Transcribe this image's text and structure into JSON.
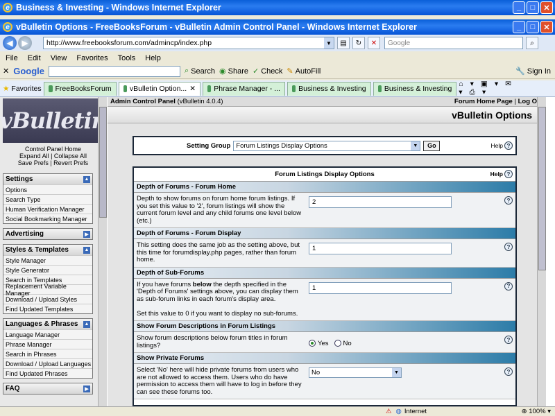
{
  "back_window": {
    "title": "Business & Investing - Windows Internet Explorer"
  },
  "window": {
    "title": "vBulletin Options - FreeBooksForum - vBulletin Admin Control Panel - Windows Internet Explorer"
  },
  "address": {
    "url": "http://www.freebooksforum.com/admincp/index.php",
    "search_placeholder": "Google"
  },
  "menu": [
    "File",
    "Edit",
    "View",
    "Favorites",
    "Tools",
    "Help"
  ],
  "google_bar": {
    "brand": "Google",
    "search": "Search",
    "share": "Share",
    "check": "Check",
    "autofill": "AutoFill",
    "sign_in": "Sign In"
  },
  "tabs_bar": {
    "favorites": "Favorites",
    "tabs": [
      "FreeBooksForum",
      "vBulletin Option...",
      "Phrase Manager - ...",
      "Business & Investing",
      "Business & Investing"
    ]
  },
  "sidebar": {
    "logo": "vBulletin",
    "cp_home": "Control Panel Home",
    "expand_all": "Expand All",
    "collapse_all": "Collapse All",
    "save_prefs": "Save Prefs",
    "revert_prefs": "Revert Prefs",
    "groups": [
      {
        "title": "Settings",
        "items": [
          "Options",
          "Search Type",
          "Human Verification Manager",
          "Social Bookmarking Manager"
        ]
      },
      {
        "title": "Advertising",
        "items": []
      },
      {
        "title": "Styles & Templates",
        "items": [
          "Style Manager",
          "Style Generator",
          "Search in Templates",
          "Replacement Variable Manager",
          "Download / Upload Styles",
          "Find Updated Templates"
        ]
      },
      {
        "title": "Languages & Phrases",
        "items": [
          "Language Manager",
          "Phrase Manager",
          "Search in Phrases",
          "Download / Upload Languages",
          "Find Updated Phrases"
        ]
      },
      {
        "title": "FAQ",
        "items": []
      }
    ]
  },
  "header": {
    "acp": "Admin Control Panel",
    "version": "(vBulletin 4.0.4)",
    "home": "Forum Home Page",
    "logout": "Log Out",
    "page_title": "vBulletin Options"
  },
  "setting_group": {
    "label": "Setting Group",
    "value": "Forum Listings Display Options",
    "go": "Go",
    "help": "Help"
  },
  "options": {
    "title": "Forum Listings Display Options",
    "help": "Help",
    "s1": {
      "title": "Depth of Forums - Forum Home",
      "desc": "Depth to show forums on forum home forum listings. If you set this value to '2', forum listings will show the current forum level and any child forums one level below (etc.)",
      "value": "2"
    },
    "s2": {
      "title": "Depth of Forums - Forum Display",
      "desc": "This setting does the same job as the setting above, but this time for forumdisplay.php pages, rather than forum home.",
      "value": "1"
    },
    "s3": {
      "title": "Depth of Sub-Forums",
      "desc_a": "If you have forums ",
      "desc_bold": "below",
      "desc_b": " the depth specified in the 'Depth of Forums' settings above, you can display them as sub-forum links in each forum's display area.",
      "desc_c": "Set this value to 0 if you want to display no sub-forums.",
      "value": "1"
    },
    "s4": {
      "title": "Show Forum Descriptions in Forum Listings",
      "desc": "Show forum descriptions below forum titles in forum listings?",
      "yes": "Yes",
      "no": "No",
      "selected": "Yes"
    },
    "s5": {
      "title": "Show Private Forums",
      "desc": "Select 'No' here will hide private forums from users who are not allowed to access them. Users who do have permission to access them will have to log in before they can see these forums too.",
      "value": "No"
    }
  },
  "status": {
    "zone": "Internet",
    "zoom": "100%"
  }
}
